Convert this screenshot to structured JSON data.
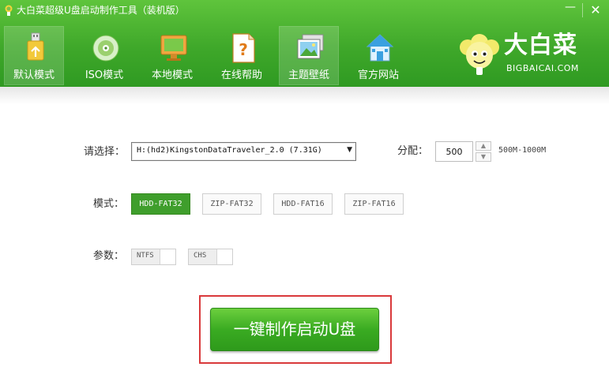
{
  "window": {
    "title": "大白菜超级U盘启动制作工具（装机版）",
    "minimize_glyph": "—",
    "close_glyph": "✕"
  },
  "tabs": [
    {
      "label": "默认模式",
      "icon": "usb-drive-icon",
      "active": true
    },
    {
      "label": "ISO模式",
      "icon": "disc-icon",
      "active": false
    },
    {
      "label": "本地模式",
      "icon": "monitor-icon",
      "active": false
    },
    {
      "label": "在线帮助",
      "icon": "help-document-icon",
      "active": false
    },
    {
      "label": "主题壁纸",
      "icon": "picture-frame-icon",
      "active": true
    },
    {
      "label": "官方网站",
      "icon": "house-icon",
      "active": false
    }
  ],
  "logo": {
    "text": "大白菜",
    "subtext": "BIGBAICAI.COM",
    "mascot_icon": "cabbage-mascot-icon"
  },
  "device_select": {
    "label": "请选择：",
    "value": "H:(hd2)KingstonDataTraveler_2.0 (7.31G)"
  },
  "partition": {
    "label": "分配：",
    "value": "500",
    "hint": "500M-1000M"
  },
  "mode": {
    "label": "模式：",
    "options": [
      "HDD-FAT32",
      "ZIP-FAT32",
      "HDD-FAT16",
      "ZIP-FAT16"
    ],
    "selected": "HDD-FAT32"
  },
  "params": {
    "label": "参数：",
    "toggles": [
      {
        "label": "NTFS",
        "on": false
      },
      {
        "label": "CHS",
        "on": false
      }
    ]
  },
  "make_button": {
    "label": "一键制作启动U盘"
  },
  "colors": {
    "header_green": "#3fa82a",
    "selected_mode": "#3f9e2c",
    "highlight_red": "#d9393b"
  }
}
